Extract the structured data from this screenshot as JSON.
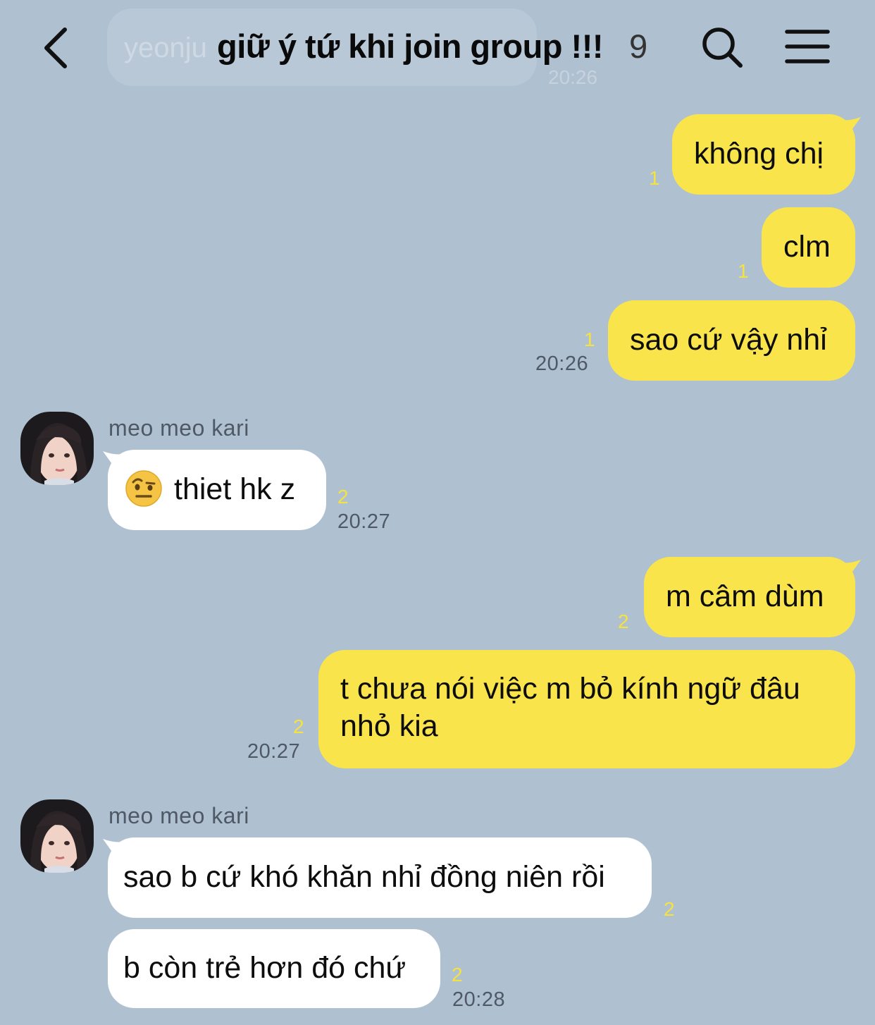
{
  "header": {
    "ghost_text": "yeonju",
    "ghost_time": "20:26",
    "title": "giữ ý tứ khi join group !!!",
    "member_count": "9",
    "icons": {
      "back": "chevron-left-icon",
      "search": "search-icon",
      "menu": "hamburger-menu-icon"
    }
  },
  "colors": {
    "background": "#afc1d1",
    "my_bubble": "#f9e54b",
    "their_bubble": "#ffffff",
    "read_count": "#f5e23f",
    "meta_text": "#4f5965"
  },
  "messages": [
    {
      "side": "mine",
      "text": "không chị",
      "read": "1"
    },
    {
      "side": "mine",
      "text": "clm",
      "read": "1"
    },
    {
      "side": "mine",
      "text": "sao cứ vậy nhỉ",
      "read": "1",
      "time": "20:26"
    },
    {
      "side": "theirs",
      "sender": "meo meo kari",
      "emoji": "face-with-raised-eyebrow",
      "text": "thiet hk z",
      "read": "2",
      "time": "20:27"
    },
    {
      "side": "mine",
      "text": "m câm dùm",
      "read": "2"
    },
    {
      "side": "mine",
      "lines": [
        "t chưa nói việc m bỏ kính ngữ đâu",
        "nhỏ kia"
      ],
      "read": "2",
      "time": "20:27"
    },
    {
      "side": "theirs",
      "sender": "meo meo kari",
      "text": "sao b cứ khó khăn nhỉ đồng niên rồi",
      "read": "2"
    },
    {
      "side": "theirs",
      "text": "b còn trẻ hơn đó chứ",
      "read": "2",
      "time": "20:28"
    }
  ]
}
